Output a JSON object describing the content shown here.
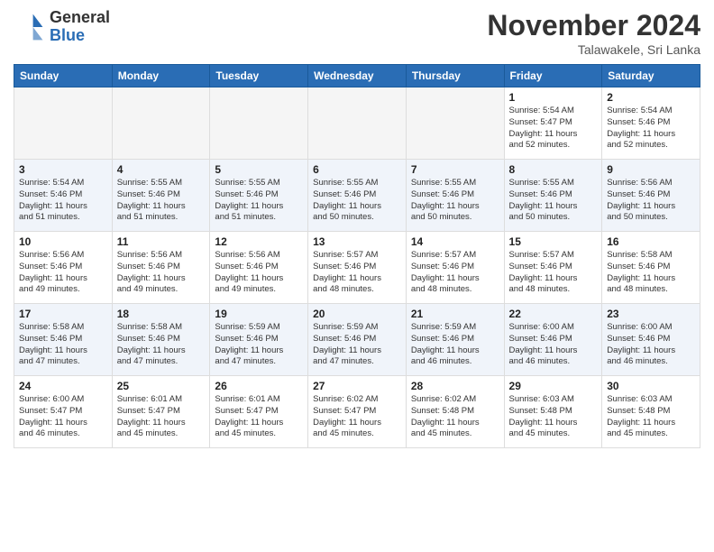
{
  "header": {
    "logo_general": "General",
    "logo_blue": "Blue",
    "month_title": "November 2024",
    "location": "Talawakele, Sri Lanka"
  },
  "weekdays": [
    "Sunday",
    "Monday",
    "Tuesday",
    "Wednesday",
    "Thursday",
    "Friday",
    "Saturday"
  ],
  "weeks": [
    [
      {
        "day": "",
        "info": ""
      },
      {
        "day": "",
        "info": ""
      },
      {
        "day": "",
        "info": ""
      },
      {
        "day": "",
        "info": ""
      },
      {
        "day": "",
        "info": ""
      },
      {
        "day": "1",
        "info": "Sunrise: 5:54 AM\nSunset: 5:47 PM\nDaylight: 11 hours\nand 52 minutes."
      },
      {
        "day": "2",
        "info": "Sunrise: 5:54 AM\nSunset: 5:46 PM\nDaylight: 11 hours\nand 52 minutes."
      }
    ],
    [
      {
        "day": "3",
        "info": "Sunrise: 5:54 AM\nSunset: 5:46 PM\nDaylight: 11 hours\nand 51 minutes."
      },
      {
        "day": "4",
        "info": "Sunrise: 5:55 AM\nSunset: 5:46 PM\nDaylight: 11 hours\nand 51 minutes."
      },
      {
        "day": "5",
        "info": "Sunrise: 5:55 AM\nSunset: 5:46 PM\nDaylight: 11 hours\nand 51 minutes."
      },
      {
        "day": "6",
        "info": "Sunrise: 5:55 AM\nSunset: 5:46 PM\nDaylight: 11 hours\nand 50 minutes."
      },
      {
        "day": "7",
        "info": "Sunrise: 5:55 AM\nSunset: 5:46 PM\nDaylight: 11 hours\nand 50 minutes."
      },
      {
        "day": "8",
        "info": "Sunrise: 5:55 AM\nSunset: 5:46 PM\nDaylight: 11 hours\nand 50 minutes."
      },
      {
        "day": "9",
        "info": "Sunrise: 5:56 AM\nSunset: 5:46 PM\nDaylight: 11 hours\nand 50 minutes."
      }
    ],
    [
      {
        "day": "10",
        "info": "Sunrise: 5:56 AM\nSunset: 5:46 PM\nDaylight: 11 hours\nand 49 minutes."
      },
      {
        "day": "11",
        "info": "Sunrise: 5:56 AM\nSunset: 5:46 PM\nDaylight: 11 hours\nand 49 minutes."
      },
      {
        "day": "12",
        "info": "Sunrise: 5:56 AM\nSunset: 5:46 PM\nDaylight: 11 hours\nand 49 minutes."
      },
      {
        "day": "13",
        "info": "Sunrise: 5:57 AM\nSunset: 5:46 PM\nDaylight: 11 hours\nand 48 minutes."
      },
      {
        "day": "14",
        "info": "Sunrise: 5:57 AM\nSunset: 5:46 PM\nDaylight: 11 hours\nand 48 minutes."
      },
      {
        "day": "15",
        "info": "Sunrise: 5:57 AM\nSunset: 5:46 PM\nDaylight: 11 hours\nand 48 minutes."
      },
      {
        "day": "16",
        "info": "Sunrise: 5:58 AM\nSunset: 5:46 PM\nDaylight: 11 hours\nand 48 minutes."
      }
    ],
    [
      {
        "day": "17",
        "info": "Sunrise: 5:58 AM\nSunset: 5:46 PM\nDaylight: 11 hours\nand 47 minutes."
      },
      {
        "day": "18",
        "info": "Sunrise: 5:58 AM\nSunset: 5:46 PM\nDaylight: 11 hours\nand 47 minutes."
      },
      {
        "day": "19",
        "info": "Sunrise: 5:59 AM\nSunset: 5:46 PM\nDaylight: 11 hours\nand 47 minutes."
      },
      {
        "day": "20",
        "info": "Sunrise: 5:59 AM\nSunset: 5:46 PM\nDaylight: 11 hours\nand 47 minutes."
      },
      {
        "day": "21",
        "info": "Sunrise: 5:59 AM\nSunset: 5:46 PM\nDaylight: 11 hours\nand 46 minutes."
      },
      {
        "day": "22",
        "info": "Sunrise: 6:00 AM\nSunset: 5:46 PM\nDaylight: 11 hours\nand 46 minutes."
      },
      {
        "day": "23",
        "info": "Sunrise: 6:00 AM\nSunset: 5:46 PM\nDaylight: 11 hours\nand 46 minutes."
      }
    ],
    [
      {
        "day": "24",
        "info": "Sunrise: 6:00 AM\nSunset: 5:47 PM\nDaylight: 11 hours\nand 46 minutes."
      },
      {
        "day": "25",
        "info": "Sunrise: 6:01 AM\nSunset: 5:47 PM\nDaylight: 11 hours\nand 45 minutes."
      },
      {
        "day": "26",
        "info": "Sunrise: 6:01 AM\nSunset: 5:47 PM\nDaylight: 11 hours\nand 45 minutes."
      },
      {
        "day": "27",
        "info": "Sunrise: 6:02 AM\nSunset: 5:47 PM\nDaylight: 11 hours\nand 45 minutes."
      },
      {
        "day": "28",
        "info": "Sunrise: 6:02 AM\nSunset: 5:48 PM\nDaylight: 11 hours\nand 45 minutes."
      },
      {
        "day": "29",
        "info": "Sunrise: 6:03 AM\nSunset: 5:48 PM\nDaylight: 11 hours\nand 45 minutes."
      },
      {
        "day": "30",
        "info": "Sunrise: 6:03 AM\nSunset: 5:48 PM\nDaylight: 11 hours\nand 45 minutes."
      }
    ]
  ]
}
